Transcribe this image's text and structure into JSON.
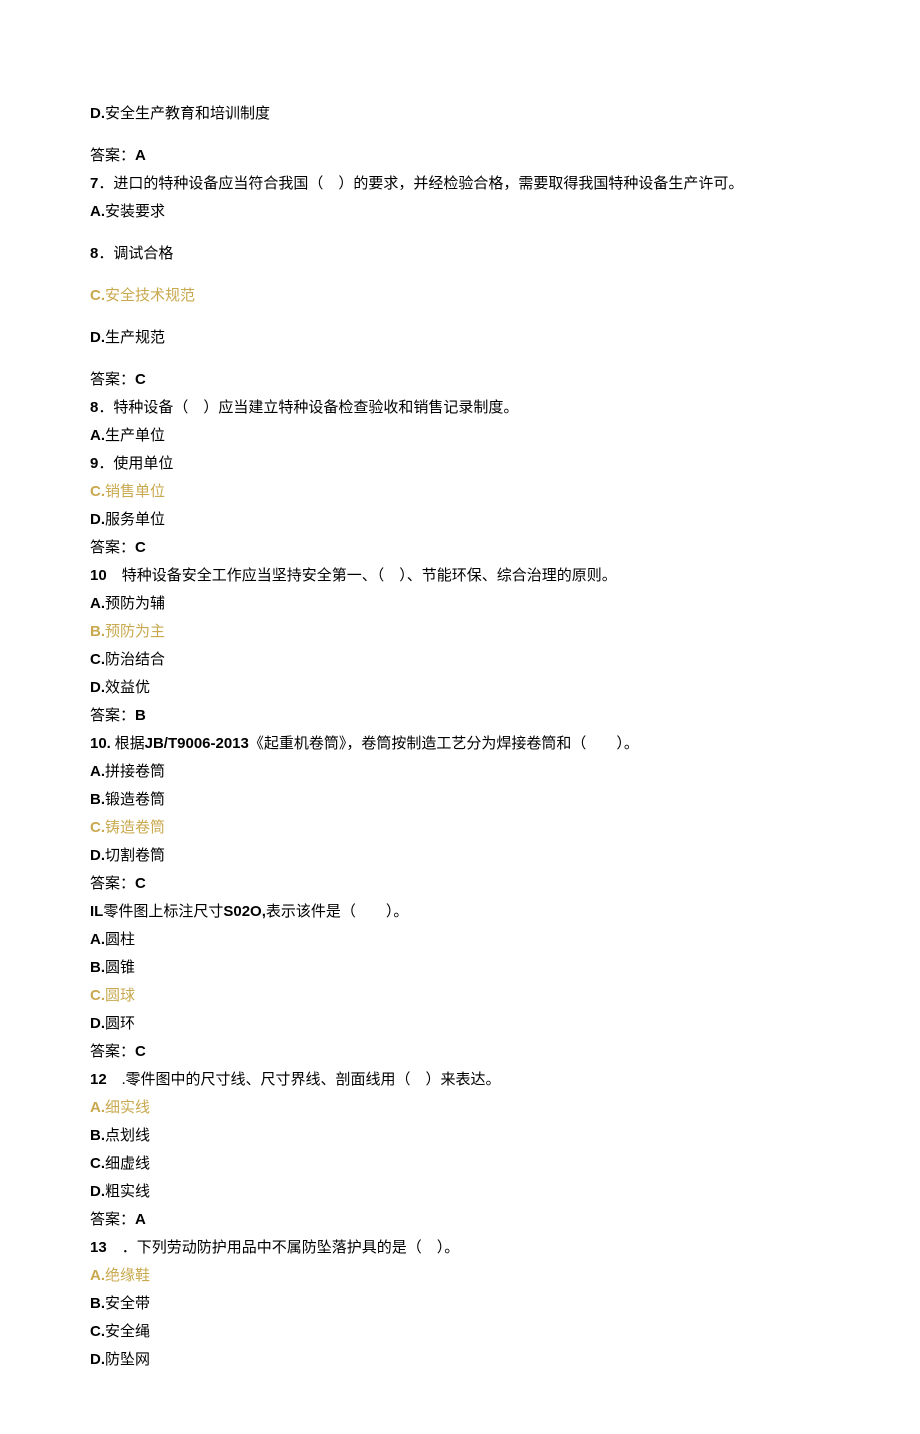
{
  "lines": [
    {
      "prefix": "D.",
      "prefixBold": true,
      "text": "安全生产教育和培训制度",
      "highlight": false,
      "spaceAfter": true
    },
    {
      "prefix": "",
      "prefixBold": false,
      "text": "答案：",
      "suffix": "A",
      "suffixBold": true,
      "highlight": false
    },
    {
      "prefix": "7",
      "prefixBold": true,
      "text": "．进口的特种设备应当符合我国（　）的要求，并经检验合格，需要取得我国特种设备生产许可。",
      "highlight": false
    },
    {
      "prefix": "A.",
      "prefixBold": true,
      "text": "安装要求",
      "highlight": false,
      "spaceAfter": true
    },
    {
      "prefix": "8",
      "prefixBold": true,
      "text": "．调试合格",
      "highlight": false,
      "spaceAfter": true
    },
    {
      "prefix": "C.",
      "prefixBold": true,
      "text": "安全技术规范",
      "highlight": true,
      "spaceAfter": true
    },
    {
      "prefix": "D.",
      "prefixBold": true,
      "text": "生产规范",
      "highlight": false,
      "spaceAfter": true
    },
    {
      "prefix": "",
      "prefixBold": false,
      "text": "答案：",
      "suffix": "C",
      "suffixBold": true,
      "highlight": false
    },
    {
      "prefix": "8",
      "prefixBold": true,
      "text": "．特种设备（　）应当建立特种设备检查验收和销售记录制度。",
      "highlight": false
    },
    {
      "prefix": "A.",
      "prefixBold": true,
      "text": "生产单位",
      "highlight": false
    },
    {
      "prefix": "9",
      "prefixBold": true,
      "text": "．使用单位",
      "highlight": false
    },
    {
      "prefix": "C.",
      "prefixBold": true,
      "text": "销售单位",
      "highlight": true
    },
    {
      "prefix": "D.",
      "prefixBold": true,
      "text": "服务单位",
      "highlight": false
    },
    {
      "prefix": "",
      "prefixBold": false,
      "text": "答案：",
      "suffix": "C",
      "suffixBold": true,
      "highlight": false
    },
    {
      "prefix": "10",
      "prefixBold": true,
      "text": "　特种设备安全工作应当坚持安全第一、（　）、节能环保、综合治理的原则。",
      "highlight": false
    },
    {
      "prefix": "A.",
      "prefixBold": true,
      "text": "预防为辅",
      "highlight": false
    },
    {
      "prefix": "B.",
      "prefixBold": true,
      "text": "预防为主",
      "highlight": true
    },
    {
      "prefix": "C.",
      "prefixBold": true,
      "text": "防治结合",
      "highlight": false
    },
    {
      "prefix": "D.",
      "prefixBold": true,
      "text": "效益优",
      "highlight": false
    },
    {
      "prefix": "",
      "prefixBold": false,
      "text": "答案：",
      "suffix": "B",
      "suffixBold": true,
      "highlight": false
    },
    {
      "prefix": "10.",
      "prefixBold": true,
      "text": " 根据",
      "mid": "JB/T9006-2013",
      "midBold": true,
      "text2": "《起重机卷筒》，卷筒按制造工艺分为焊接卷筒和（　　）。",
      "highlight": false
    },
    {
      "prefix": "A.",
      "prefixBold": true,
      "text": "拼接卷筒",
      "highlight": false
    },
    {
      "prefix": "B.",
      "prefixBold": true,
      "text": "锻造卷筒",
      "highlight": false
    },
    {
      "prefix": "C.",
      "prefixBold": true,
      "text": "铸造卷筒",
      "highlight": true
    },
    {
      "prefix": "D.",
      "prefixBold": true,
      "text": "切割卷筒",
      "highlight": false
    },
    {
      "prefix": "",
      "prefixBold": false,
      "text": "答案：",
      "suffix": "C",
      "suffixBold": true,
      "highlight": false
    },
    {
      "prefix": "IL",
      "prefixBold": true,
      "text": "零件图上标注尺寸",
      "mid": "S02O,",
      "midBold": true,
      "text2": "表示该件是（　　）。",
      "highlight": false
    },
    {
      "prefix": "A.",
      "prefixBold": true,
      "text": "圆柱",
      "highlight": false
    },
    {
      "prefix": "B.",
      "prefixBold": true,
      "text": "圆锥",
      "highlight": false
    },
    {
      "prefix": "C.",
      "prefixBold": true,
      "text": "圆球",
      "highlight": true
    },
    {
      "prefix": "D.",
      "prefixBold": true,
      "text": "圆环",
      "highlight": false
    },
    {
      "prefix": "",
      "prefixBold": false,
      "text": "答案：",
      "suffix": "C",
      "suffixBold": true,
      "highlight": false
    },
    {
      "prefix": "12",
      "prefixBold": true,
      "text": "　.零件图中的尺寸线、尺寸界线、剖面线用（　）来表达。",
      "highlight": false
    },
    {
      "prefix": "A.",
      "prefixBold": true,
      "text": "细实线",
      "highlight": true
    },
    {
      "prefix": "B.",
      "prefixBold": true,
      "text": "点划线",
      "highlight": false
    },
    {
      "prefix": "C.",
      "prefixBold": true,
      "text": "细虚线",
      "highlight": false
    },
    {
      "prefix": "D.",
      "prefixBold": true,
      "text": "粗实线",
      "highlight": false
    },
    {
      "prefix": "",
      "prefixBold": false,
      "text": "答案：",
      "suffix": "A",
      "suffixBold": true,
      "highlight": false
    },
    {
      "prefix": "13",
      "prefixBold": true,
      "text": "　．下列劳动防护用品中不属防坠落护具的是（　）。",
      "highlight": false
    },
    {
      "prefix": "A.",
      "prefixBold": true,
      "text": "绝缘鞋",
      "highlight": true
    },
    {
      "prefix": "B.",
      "prefixBold": true,
      "text": "安全带",
      "highlight": false
    },
    {
      "prefix": "C.",
      "prefixBold": true,
      "text": "安全绳",
      "highlight": false
    },
    {
      "prefix": "D.",
      "prefixBold": true,
      "text": "防坠网",
      "highlight": false
    }
  ]
}
